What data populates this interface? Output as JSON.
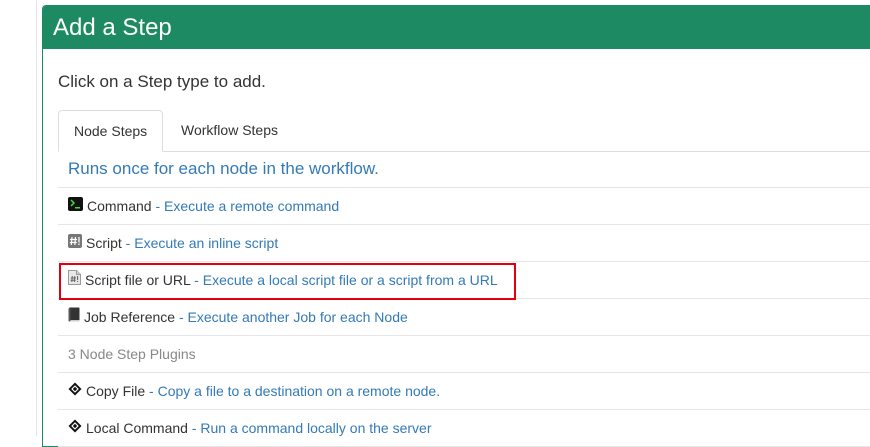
{
  "panel": {
    "title": "Add a Step",
    "instruction": "Click on a Step type to add."
  },
  "tabs": [
    {
      "label": "Node Steps",
      "active": true
    },
    {
      "label": "Workflow Steps",
      "active": false
    }
  ],
  "node_steps": {
    "header": "Runs once for each node in the workflow.",
    "items": [
      {
        "name": "Command",
        "desc": "Execute a remote command",
        "icon": "terminal-icon"
      },
      {
        "name": "Script",
        "desc": "Execute an inline script",
        "icon": "script-hash-icon"
      },
      {
        "name": "Script file or URL",
        "desc": "Execute a local script file or a script from a URL",
        "icon": "script-file-icon"
      },
      {
        "name": "Job Reference",
        "desc": "Execute another Job for each Node",
        "icon": "book-icon"
      }
    ],
    "plugins_label": "3 Node Step Plugins",
    "plugins": [
      {
        "name": "Copy File",
        "desc": "Copy a file to a destination on a remote node.",
        "icon": "diamond-icon"
      },
      {
        "name": "Local Command",
        "desc": "Run a command locally on the server",
        "icon": "diamond-icon"
      }
    ],
    "separator": " - "
  },
  "colors": {
    "header_bg": "#1e8a63",
    "link": "#337ab7",
    "highlight": "#e0000f"
  }
}
